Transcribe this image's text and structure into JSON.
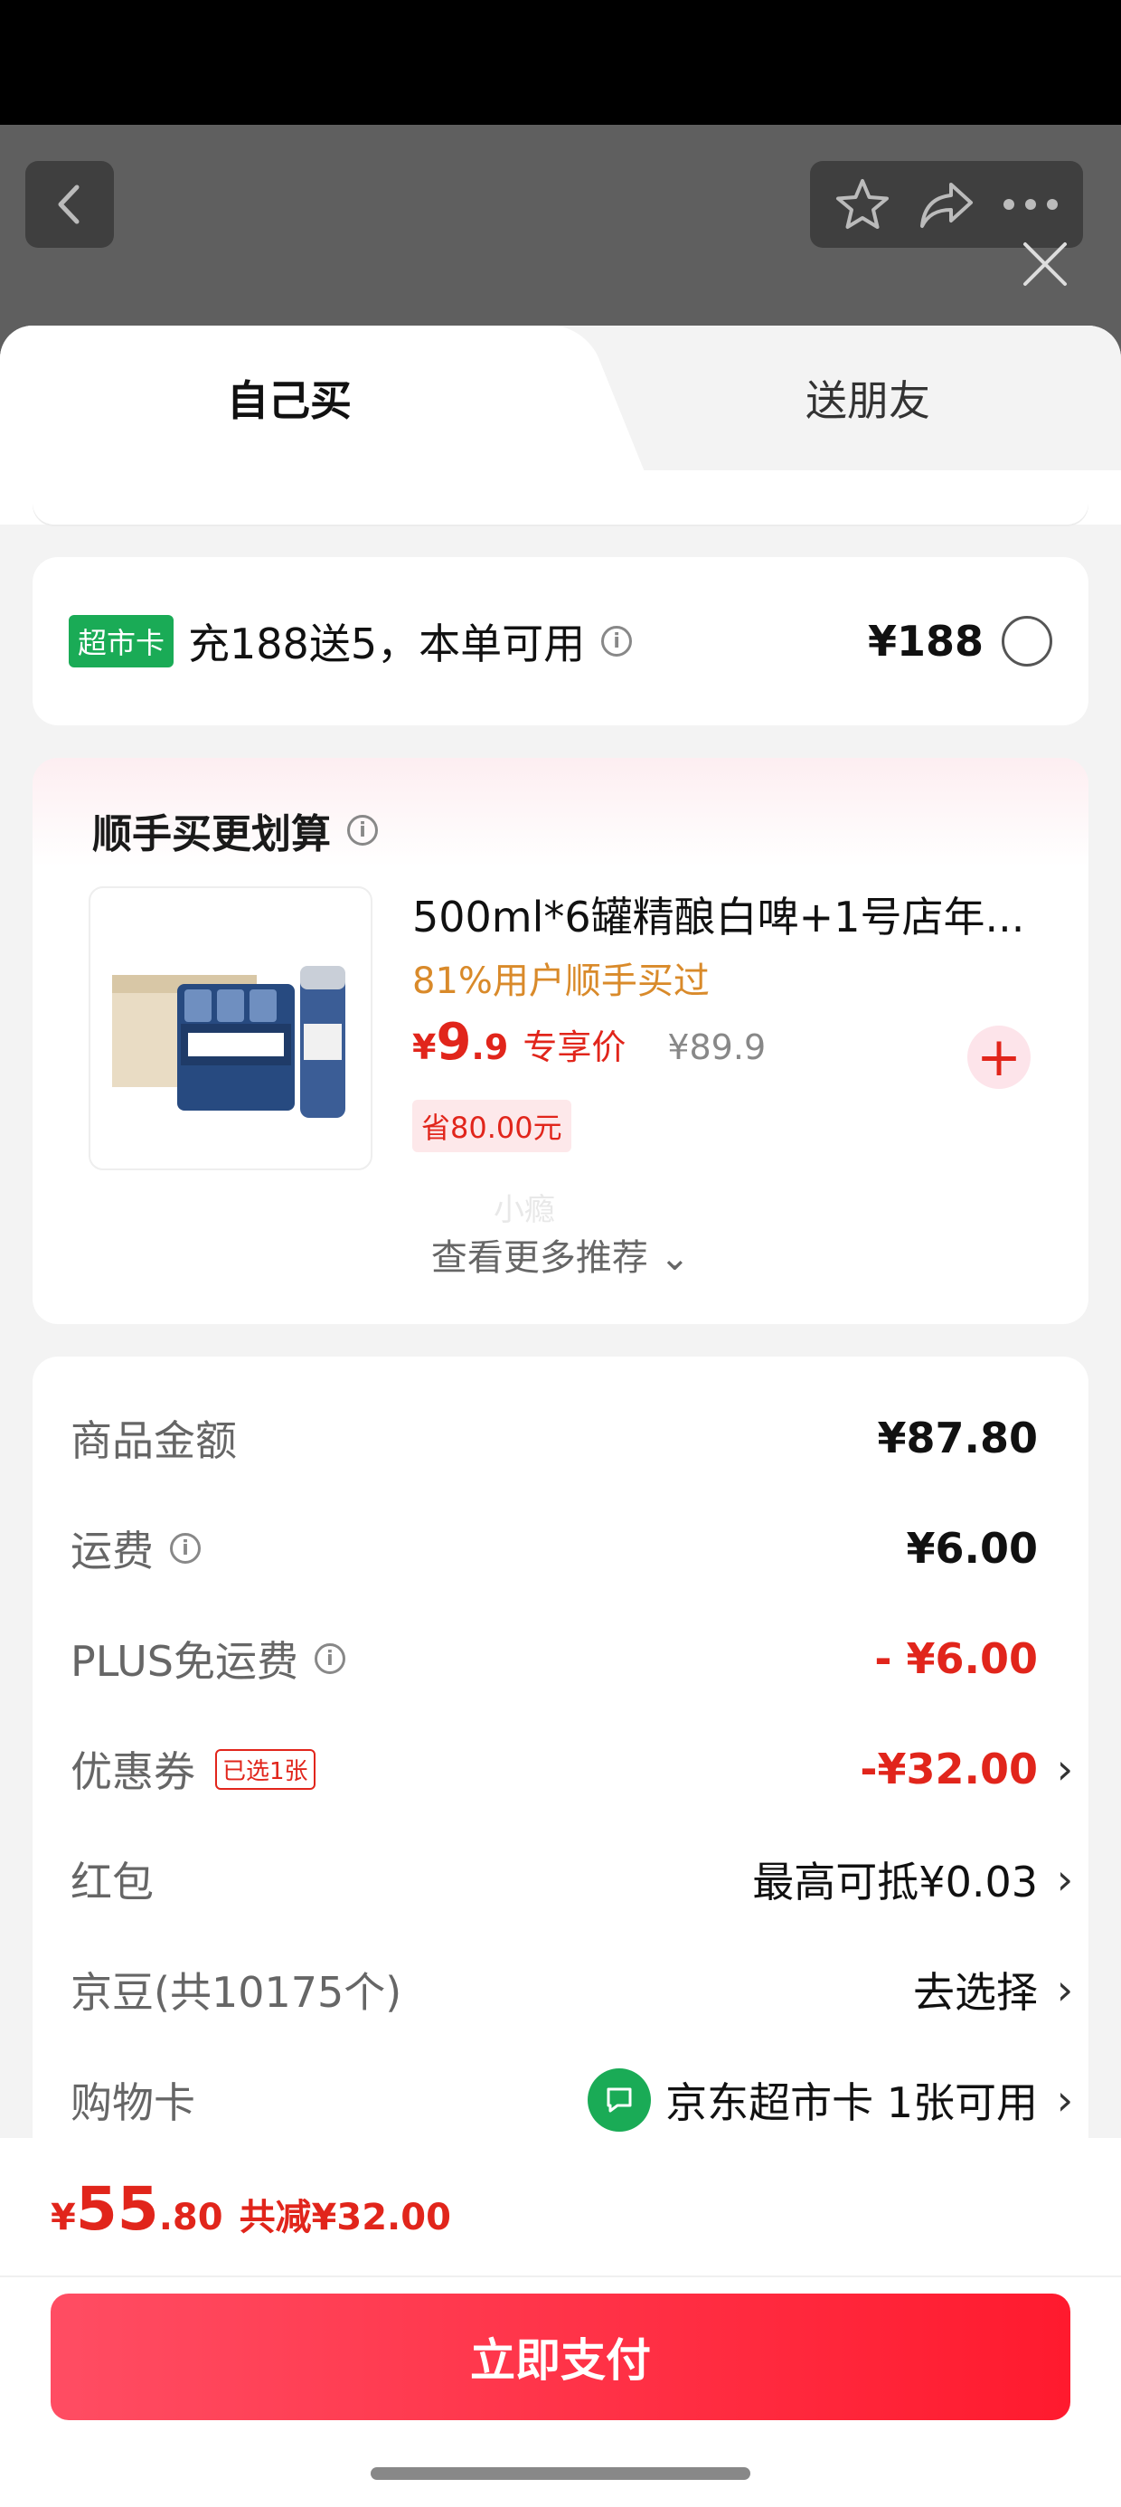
{
  "tabs": {
    "self": "自己买",
    "gift": "送朋友"
  },
  "supermarket": {
    "badge": "超市卡",
    "text": "充188送5，本单可用",
    "price": "¥188"
  },
  "recommend": {
    "title": "顺手买更划算",
    "product_name": "500ml*6罐精酿白啤+1号店年...",
    "buyers": "81%用户顺手买过",
    "price_yen": "¥",
    "price_int": "9",
    "price_dec": ".9",
    "price_tag": "专享价",
    "orig_price": "¥89.9",
    "save": "省80.00元",
    "more": "查看更多推荐 ⌄",
    "watermark": "小瘾"
  },
  "fees": [
    {
      "label": "商品金额",
      "value": "¥87.80"
    },
    {
      "label": "运费",
      "value": "¥6.00"
    },
    {
      "label": "PLUS免运费",
      "value": "- ¥6.00"
    },
    {
      "label": "优惠券",
      "badge": "已选1张",
      "value": "-¥32.00"
    },
    {
      "label": "红包",
      "value": "最高可抵¥0.03"
    },
    {
      "label": "京豆(共10175个)",
      "value": "去选择"
    },
    {
      "label": "购物卡",
      "value": "京东超市卡 1张可用"
    }
  ],
  "bottom": {
    "yen": "¥",
    "total_int": "55",
    "total_dec": ".80",
    "saved": "共减¥32.00",
    "pay": "立即支付"
  },
  "colors": {
    "accent": "#e1251b",
    "green": "#1aab56",
    "pay_start": "#ff4d63",
    "pay_end": "#ff1a2e"
  }
}
